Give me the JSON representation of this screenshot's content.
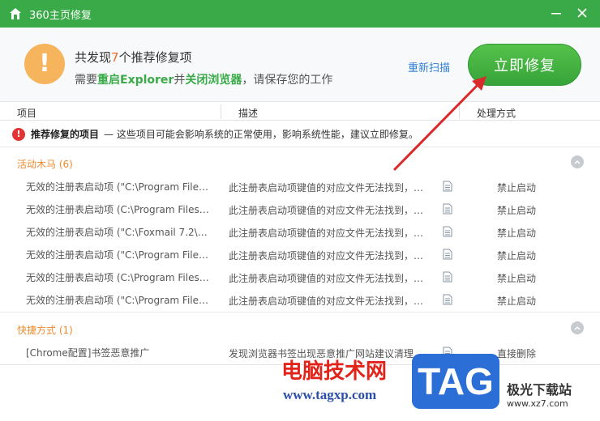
{
  "window": {
    "title": "360主页修复",
    "minimize_glyph": "—",
    "close_glyph": "✕",
    "accent": "#3aaa48"
  },
  "summary": {
    "line1_prefix": "共发现",
    "count": "7",
    "line1_suffix": "个推荐修复项",
    "line2_part1": "需要",
    "line2_hl1": "重启Explorer",
    "line2_part2": "并",
    "line2_hl2": "关闭浏览器",
    "line2_part3": "，请保存您的工作",
    "warn_glyph": "!",
    "rescan_label": "重新扫描",
    "fix_now_label": "立即修复"
  },
  "columns": [
    "项目",
    "描述",
    "处理方式"
  ],
  "notice": {
    "glyph": "!",
    "title": "推荐修复的项目",
    "desc": "— 这些项目可能会影响系统的正常使用，影响系统性能，建议立即修复。"
  },
  "sections": [
    {
      "title": "活动木马 (6)",
      "rows": [
        {
          "item": "无效的注册表启动项 (\"C:\\Program Files...",
          "desc": "此注册表启动项键值的对应文件无法找到，是...",
          "action": "禁止启动"
        },
        {
          "item": "无效的注册表启动项 (C:\\Program Files (...",
          "desc": "此注册表启动项键值的对应文件无法找到，是...",
          "action": "禁止启动"
        },
        {
          "item": "无效的注册表启动项 (\"C:\\Foxmail 7.2\\F...",
          "desc": "此注册表启动项键值的对应文件无法找到，是...",
          "action": "禁止启动"
        },
        {
          "item": "无效的注册表启动项 (\"C:\\Program Files...",
          "desc": "此注册表启动项键值的对应文件无法找到，是...",
          "action": "禁止启动"
        },
        {
          "item": "无效的注册表启动项 (C:\\Program Files (...",
          "desc": "此注册表启动项键值的对应文件无法找到，是...",
          "action": "禁止启动"
        },
        {
          "item": "无效的注册表启动项 (\"C:\\Program Files...",
          "desc": "此注册表启动项键值的对应文件无法找到，是...",
          "action": "禁止启动"
        }
      ]
    },
    {
      "title": "快捷方式 (1)",
      "rows": [
        {
          "item": "[Chrome配置]书签恶意推广",
          "desc": "发现浏览器书签出现恶意推广网站建议清理...",
          "action": "直接删除"
        }
      ]
    }
  ],
  "watermark": {
    "cn": "电脑技术网",
    "url": "www.tagxp.com",
    "tag": "TAG",
    "site": "极光下载站",
    "site_url": "www.xz7.com"
  }
}
